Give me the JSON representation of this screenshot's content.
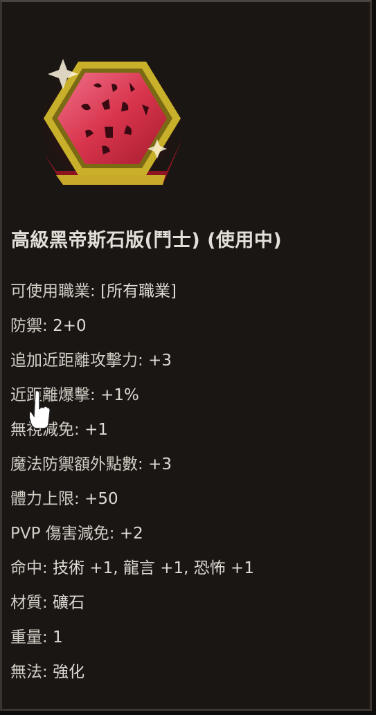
{
  "item": {
    "name": "高級黑帝斯石版(鬥士) (使用中)",
    "icon": "red-hexagon-rune-tablet-icon"
  },
  "stats": [
    {
      "label": "可使用職業: ",
      "value": "[所有職業]"
    },
    {
      "label": "防禦: ",
      "value": "2+0"
    },
    {
      "label": "追加近距離攻擊力: ",
      "value": "+3"
    },
    {
      "label": "近距離爆擊: ",
      "value": "+1%"
    },
    {
      "label": "無視減免: ",
      "value": "+1"
    },
    {
      "label": "魔法防禦額外點數: ",
      "value": "+3"
    },
    {
      "label": "體力上限: ",
      "value": "+50"
    },
    {
      "label": "PVP 傷害減免: ",
      "value": "+2"
    },
    {
      "label": "命中: ",
      "value": "技術 +1, 龍言 +1, 恐怖 +1"
    },
    {
      "label": "材質: ",
      "value": "礦石"
    },
    {
      "label": "重量: ",
      "value": "1"
    },
    {
      "label": "無法: ",
      "value": "強化"
    }
  ],
  "colors": {
    "background": "#1a1613",
    "text": "#dedad4",
    "tablet_red": "#d8354d",
    "tablet_gold": "#c9b02a"
  }
}
